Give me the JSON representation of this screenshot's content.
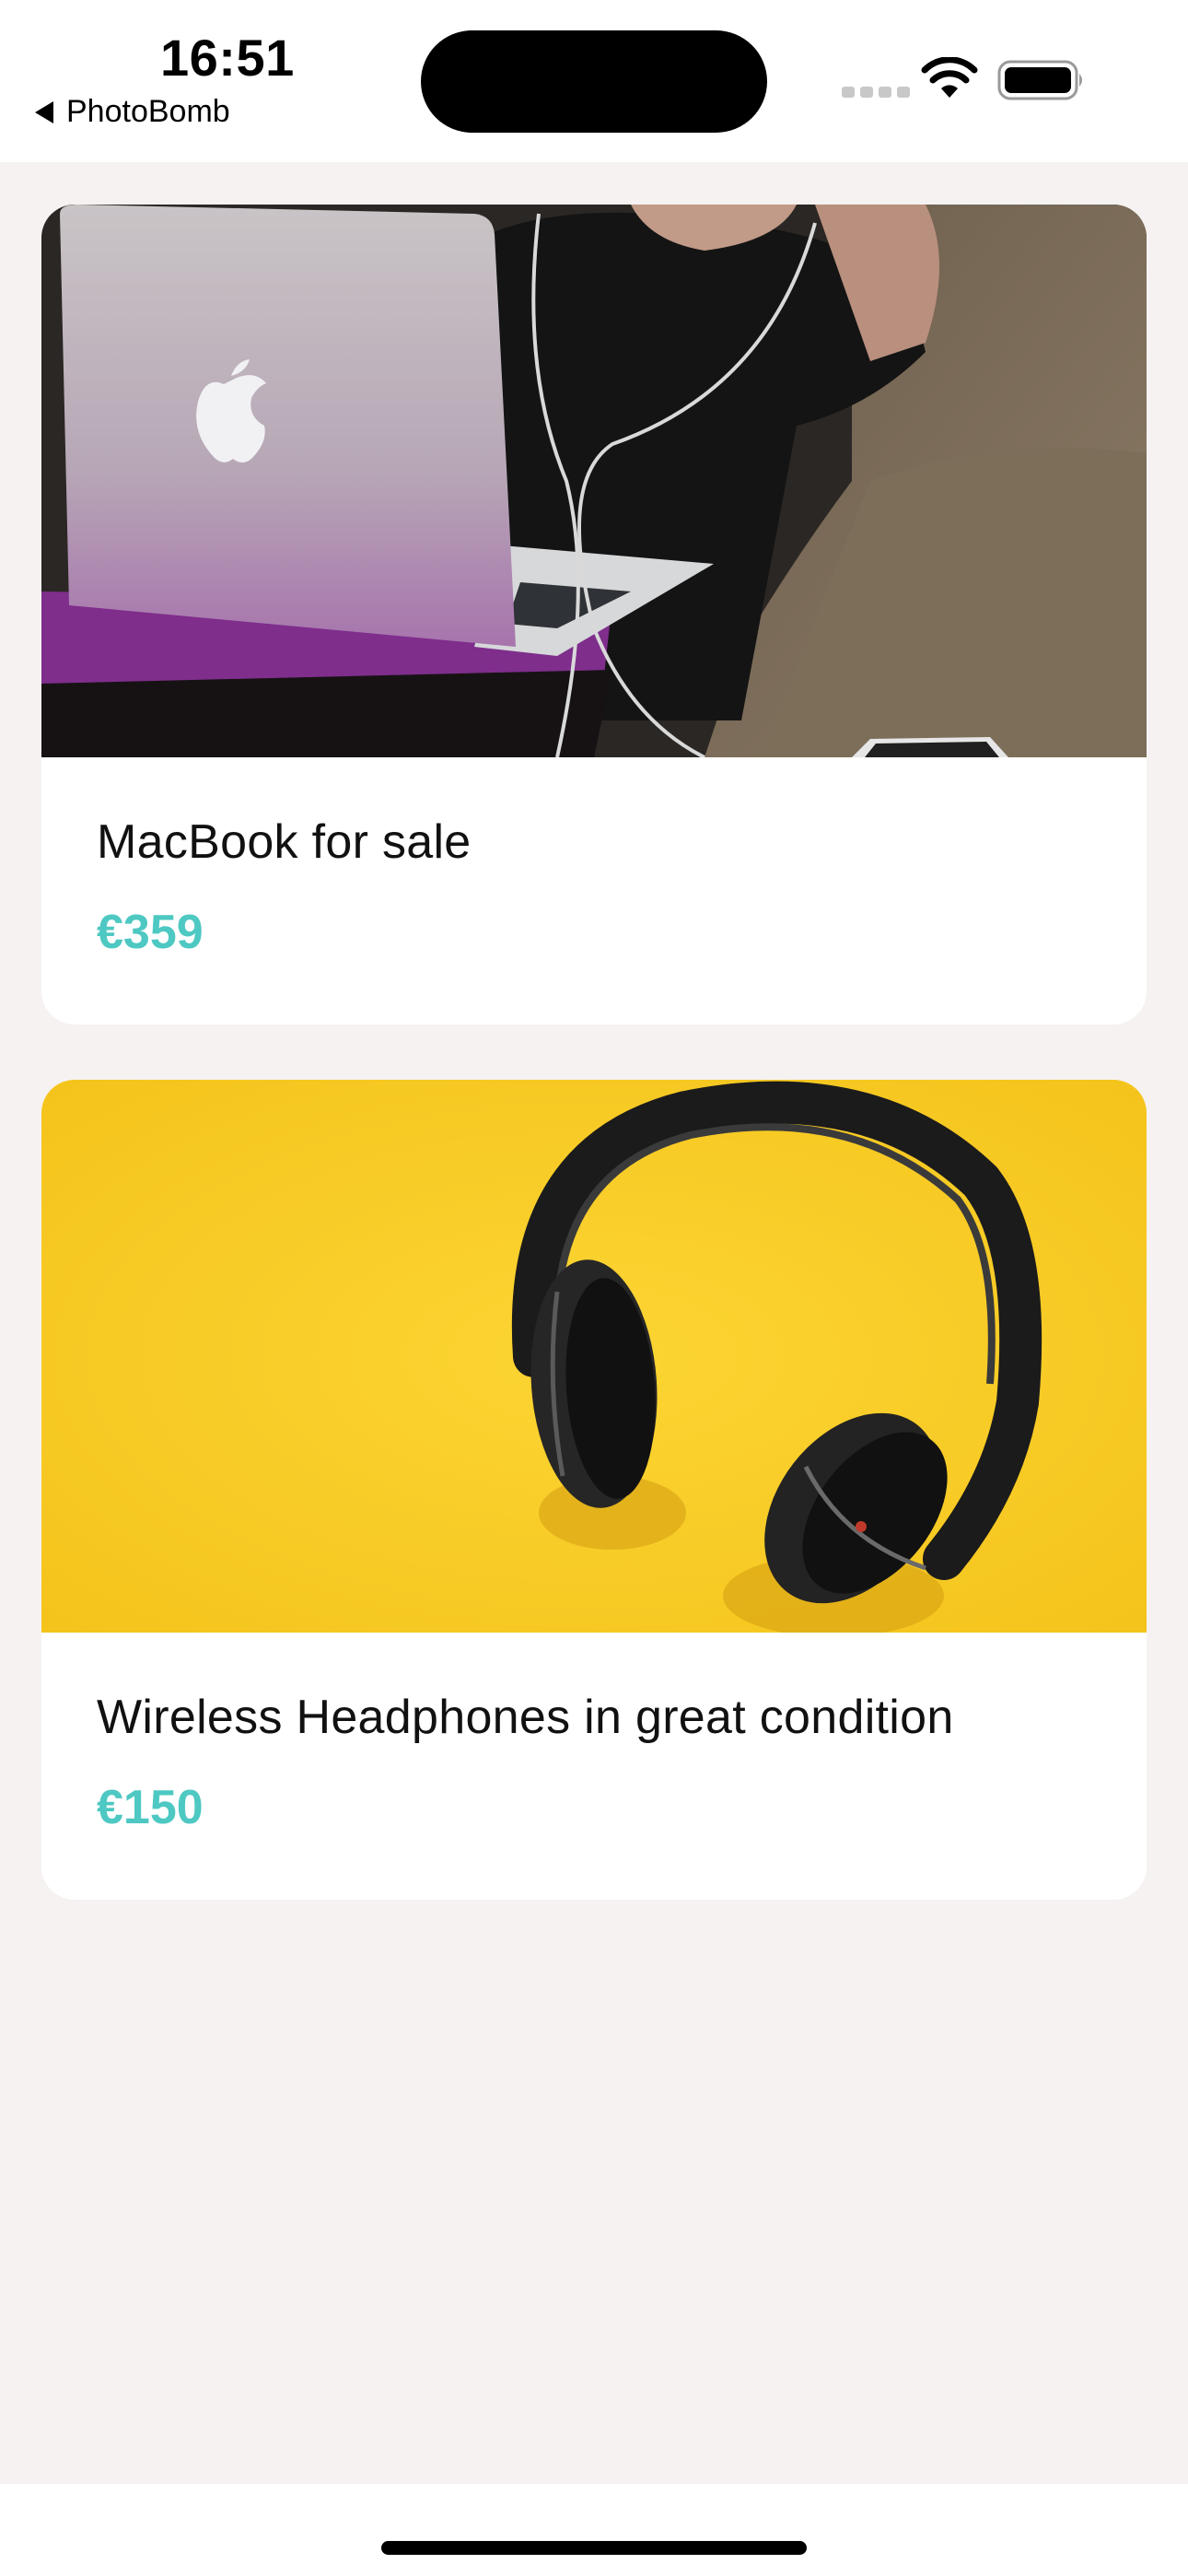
{
  "status_bar": {
    "time": "16:51",
    "back_app": "PhotoBomb"
  },
  "feed": {
    "items": [
      {
        "title": "MacBook for sale",
        "price": "€359",
        "image": "laptop-photo"
      },
      {
        "title": "Wireless Headphones in great condition",
        "price": "€150",
        "image": "headphones-photo"
      }
    ]
  },
  "colors": {
    "background": "#f5f2f1",
    "card": "#ffffff",
    "price_accent": "#4ec8c2"
  }
}
